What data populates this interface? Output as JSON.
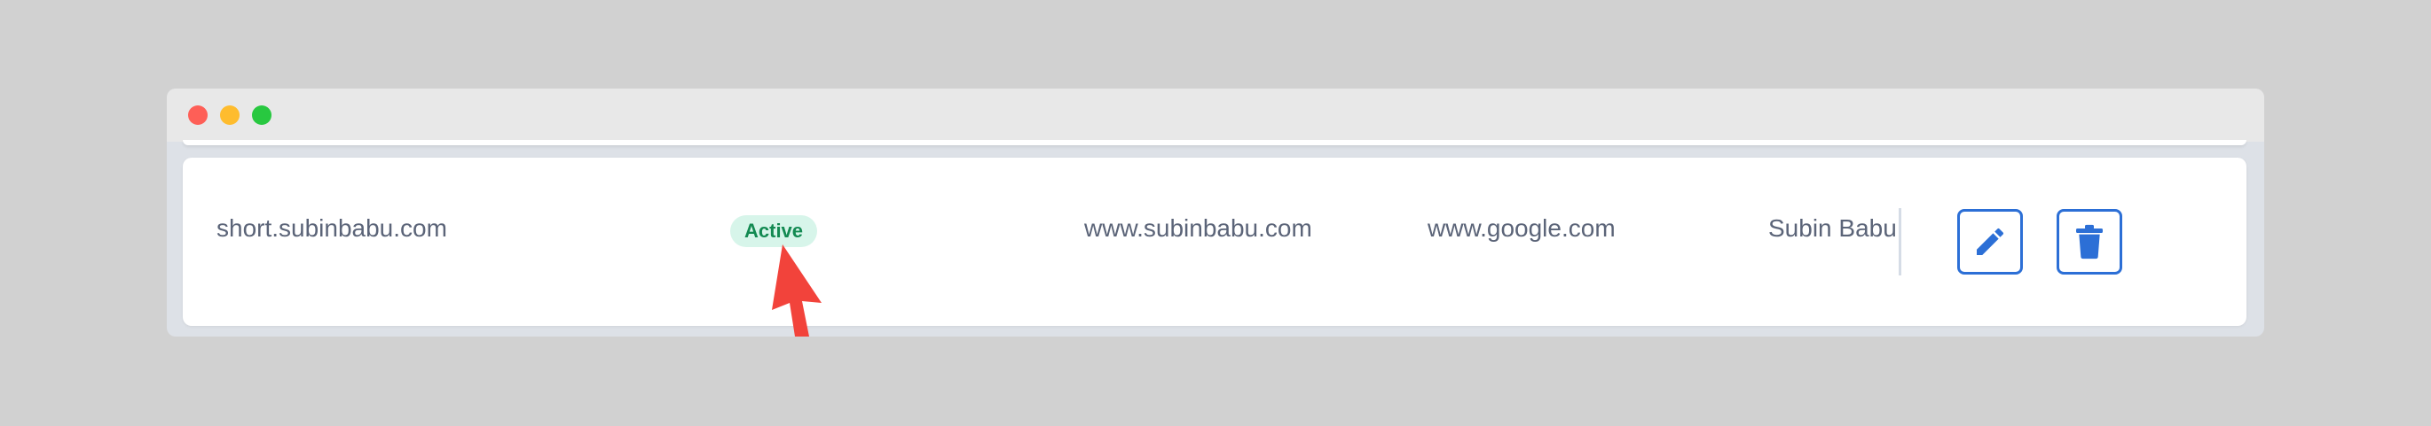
{
  "window": {
    "controls": [
      "close",
      "minimize",
      "maximize"
    ]
  },
  "row": {
    "short_url": "short.subinbabu.com",
    "status": "Active",
    "destination": "www.subinbabu.com",
    "target": "www.google.com",
    "owner": "Subin Babu"
  },
  "actions": {
    "edit_icon": "pencil-icon",
    "delete_icon": "trash-icon"
  },
  "colors": {
    "accent": "#2c6fd6",
    "status_bg": "#d7f5ea",
    "status_text": "#138a52",
    "annotation_arrow": "#f2433b"
  }
}
